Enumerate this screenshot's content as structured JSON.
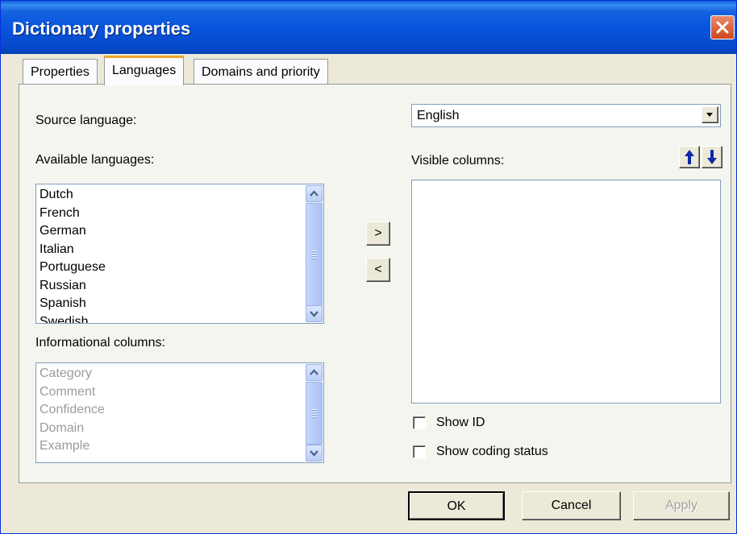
{
  "window": {
    "title": "Dictionary properties"
  },
  "tabs": [
    {
      "label": "Properties",
      "active": false
    },
    {
      "label": "Languages",
      "active": true
    },
    {
      "label": "Domains and priority",
      "active": false
    }
  ],
  "source_language": {
    "label": "Source language:",
    "value": "English"
  },
  "available_languages": {
    "label": "Available languages:",
    "items": [
      "Dutch",
      "French",
      "German",
      "Italian",
      "Portuguese",
      "Russian",
      "Spanish",
      "Swedish"
    ]
  },
  "informational_columns": {
    "label": "Informational columns:",
    "items": [
      "Category",
      "Comment",
      "Confidence",
      "Domain",
      "Example"
    ]
  },
  "move_buttons": {
    "add": ">",
    "remove": "<"
  },
  "visible_columns": {
    "label": "Visible columns:",
    "items": []
  },
  "options": {
    "show_id": "Show ID",
    "show_coding_status": "Show coding status"
  },
  "buttons": {
    "ok": "OK",
    "cancel": "Cancel",
    "apply": "Apply"
  }
}
